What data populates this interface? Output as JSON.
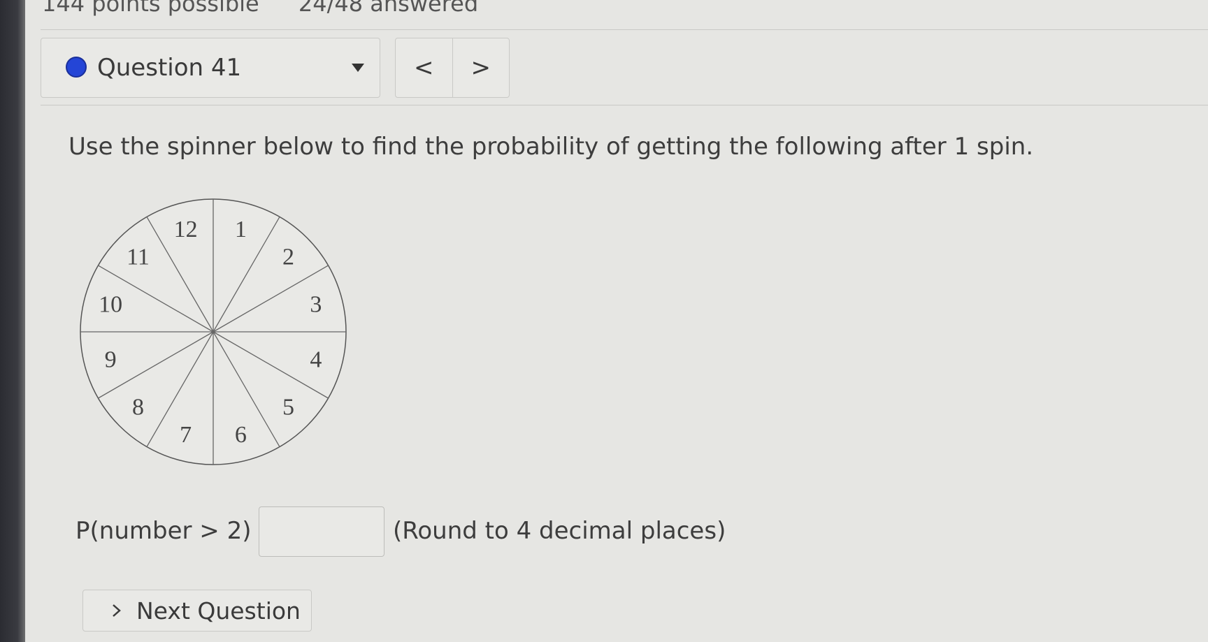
{
  "header": {
    "points_text": "144 points possible",
    "answered_text": "24/48 answered"
  },
  "question_selector": {
    "label": "Question 41",
    "status_color": "#2445d6",
    "caret_icon": "caret-down-icon"
  },
  "nav": {
    "prev_label": "<",
    "next_label": ">"
  },
  "question": {
    "prompt": "Use the spinner below to find the probability of getting the following after 1 spin.",
    "spinner_numbers": [
      "1",
      "2",
      "3",
      "4",
      "5",
      "6",
      "7",
      "8",
      "9",
      "10",
      "11",
      "12"
    ]
  },
  "answer": {
    "label": "P(number > 2) =",
    "value": "",
    "hint": "(Round to 4 decimal places)"
  },
  "next_question": {
    "icon": "chevron-right-icon",
    "label": "Next Question"
  }
}
